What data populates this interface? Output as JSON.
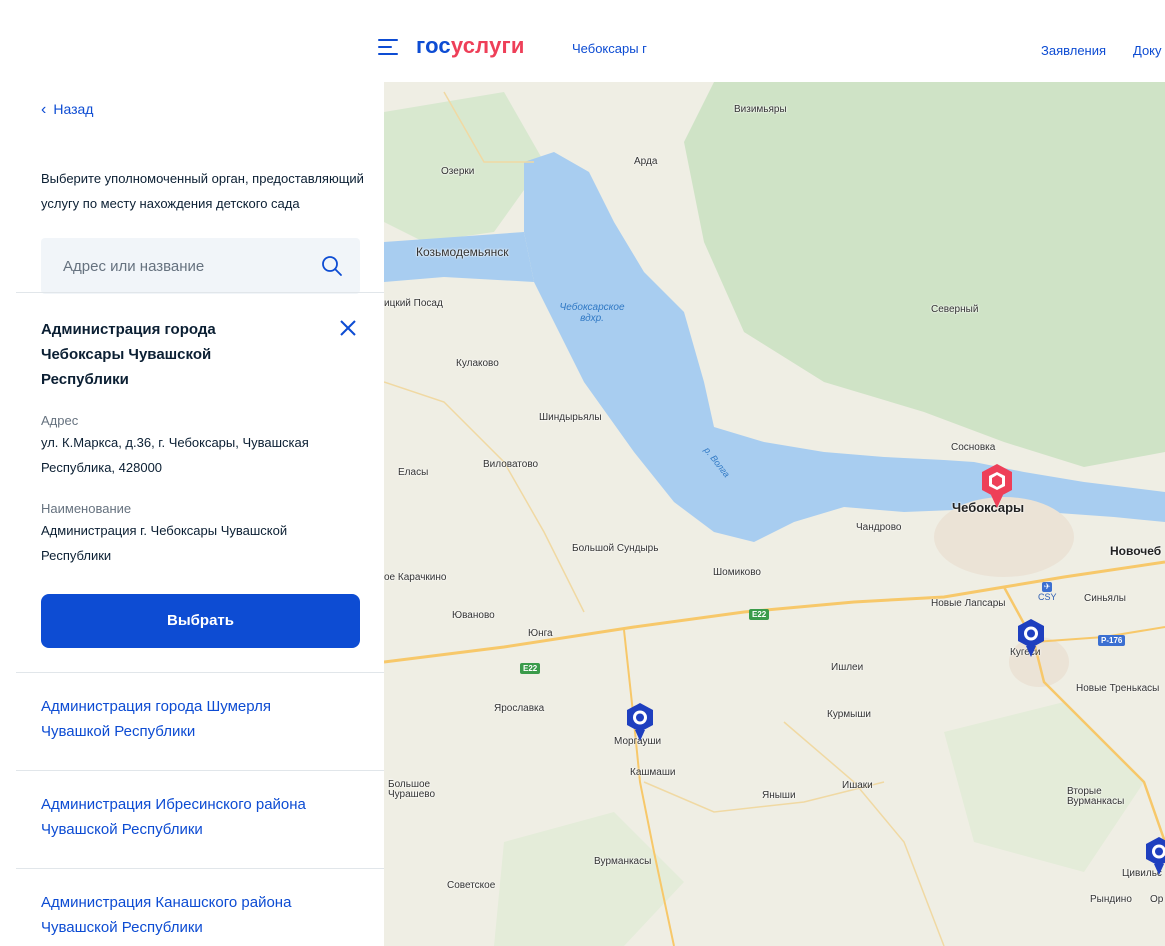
{
  "header": {
    "logo_part1": "гос",
    "logo_part2": "услуги",
    "city": "Чебоксары г",
    "nav": [
      "Заявления",
      "Доку"
    ]
  },
  "panel": {
    "back_label": "Назад",
    "intro": "Выберите уполномоченный орган, предоставляющий услугу по месту нахождения детского сада",
    "search_placeholder": "Адрес или название",
    "selected": {
      "title": "Администрация города Чебоксары Чувашской Республики",
      "address_label": "Адрес",
      "address": "ул. К.Маркса, д.36, г. Чебоксары, Чувашская Республика, 428000",
      "name_label": "Наименование",
      "name": "Администрация г. Чебоксары Чувашской Республики",
      "select_button": "Выбрать"
    },
    "orgs": [
      "Администрация города Шумерля Чувашкой Республики",
      "Администрация Ибресинского района Чувашской Республики",
      "Администрация Канашского района Чувашской Республики"
    ]
  },
  "map": {
    "places": [
      "Визимьяры",
      "Арда",
      "Озерки",
      "Козьмодемьянск",
      "ицкий Посад",
      "Северный",
      "Кулаково",
      "Шиндырьялы",
      "Сосновка",
      "Виловатово",
      "Еласы",
      "Чебоксары",
      "Чандрово",
      "Новочеб",
      "Большой Сундырь",
      "ое Карачкино",
      "Шомиково",
      "Новые Лапсары",
      "Синьялы",
      "Юваново",
      "Юнга",
      "Кугеси",
      "Ишлеи",
      "Новые Тренькасы",
      "Ярославка",
      "Моргауши",
      "Курмыши",
      "Кашмаши",
      "Большое Чурашево",
      "Яныши",
      "Ишаки",
      "Вторые Вурманкасы",
      "Вурманкасы",
      "Советское",
      "Цивильск",
      "Рындино",
      "Ор"
    ],
    "water_label": "Чебоксарское вдхр.",
    "river_label": "р. Волга",
    "road_labels": [
      "E22",
      "E22",
      "P-176"
    ],
    "airport_code": "CSY",
    "colors": {
      "water": "#a8cdf0",
      "forest": "#cfe3c6",
      "selected_pin": "#ee3f58",
      "pin": "#1e3fbf"
    }
  }
}
